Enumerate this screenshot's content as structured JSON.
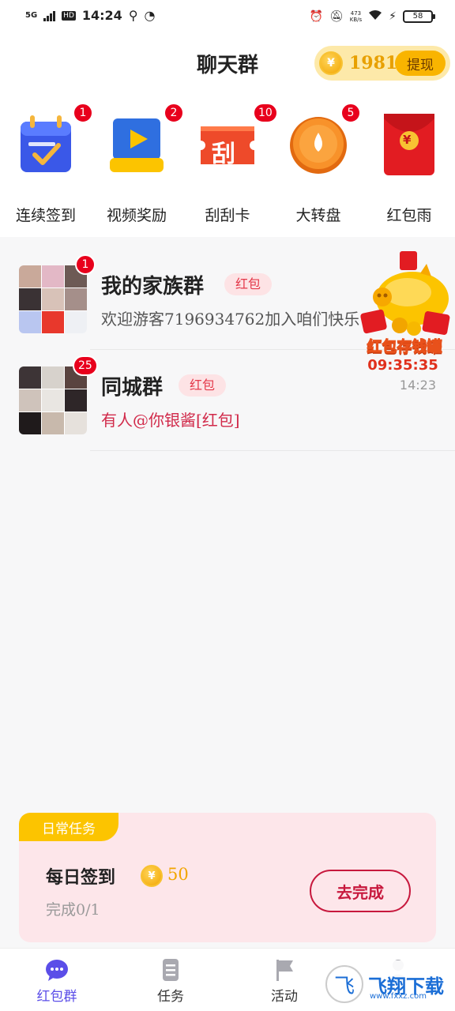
{
  "status_bar": {
    "network": "5G",
    "hd": "HD",
    "time": "14:24",
    "net_speed_value": "473",
    "net_speed_unit": "KB/s",
    "battery": "58"
  },
  "header": {
    "title": "聊天群",
    "coin_symbol": "¥",
    "coin_balance": "1981",
    "withdraw_label": "提现"
  },
  "features": [
    {
      "label": "连续签到",
      "badge": "1",
      "icon": "calendar-check-icon"
    },
    {
      "label": "视频奖励",
      "badge": "2",
      "icon": "video-play-icon"
    },
    {
      "label": "刮刮卡",
      "badge": "10",
      "icon": "scratch-card-icon",
      "glyph": "刮"
    },
    {
      "label": "大转盘",
      "badge": "5",
      "icon": "lucky-wheel-icon"
    },
    {
      "label": "红包雨",
      "badge": "",
      "icon": "red-envelope-icon",
      "glyph": "¥"
    }
  ],
  "chats": [
    {
      "name": "我的家族群",
      "tag": "红包",
      "message": "欢迎游客7196934762加入咱们快乐",
      "time": "",
      "unread": "1"
    },
    {
      "name": "同城群",
      "tag": "红包",
      "message": "有人@你银酱[红包]",
      "time": "14:23",
      "unread": "25"
    }
  ],
  "piggy_bank": {
    "title": "红包存钱罐",
    "timer": "09:35:35"
  },
  "daily_task": {
    "ribbon": "日常任务",
    "name": "每日签到",
    "coin_symbol": "¥",
    "reward": "50",
    "progress": "完成0/1",
    "button": "去完成"
  },
  "bottom_nav": [
    {
      "label": "红包群",
      "icon": "chat-bubble-icon",
      "active": true
    },
    {
      "label": "任务",
      "icon": "task-list-icon",
      "active": false
    },
    {
      "label": "活动",
      "icon": "flag-icon",
      "active": false
    },
    {
      "label": "",
      "icon": "profile-icon",
      "active": false
    }
  ],
  "watermark": {
    "logo": "飞",
    "text": "飞翔下载",
    "sub": "www.fxxz.com"
  },
  "colors": {
    "accent": "#5b4ee8",
    "badge": "#e8001c",
    "coin": "#f2a500",
    "task_bg": "#fde6ea",
    "task_button": "#c7183d"
  }
}
